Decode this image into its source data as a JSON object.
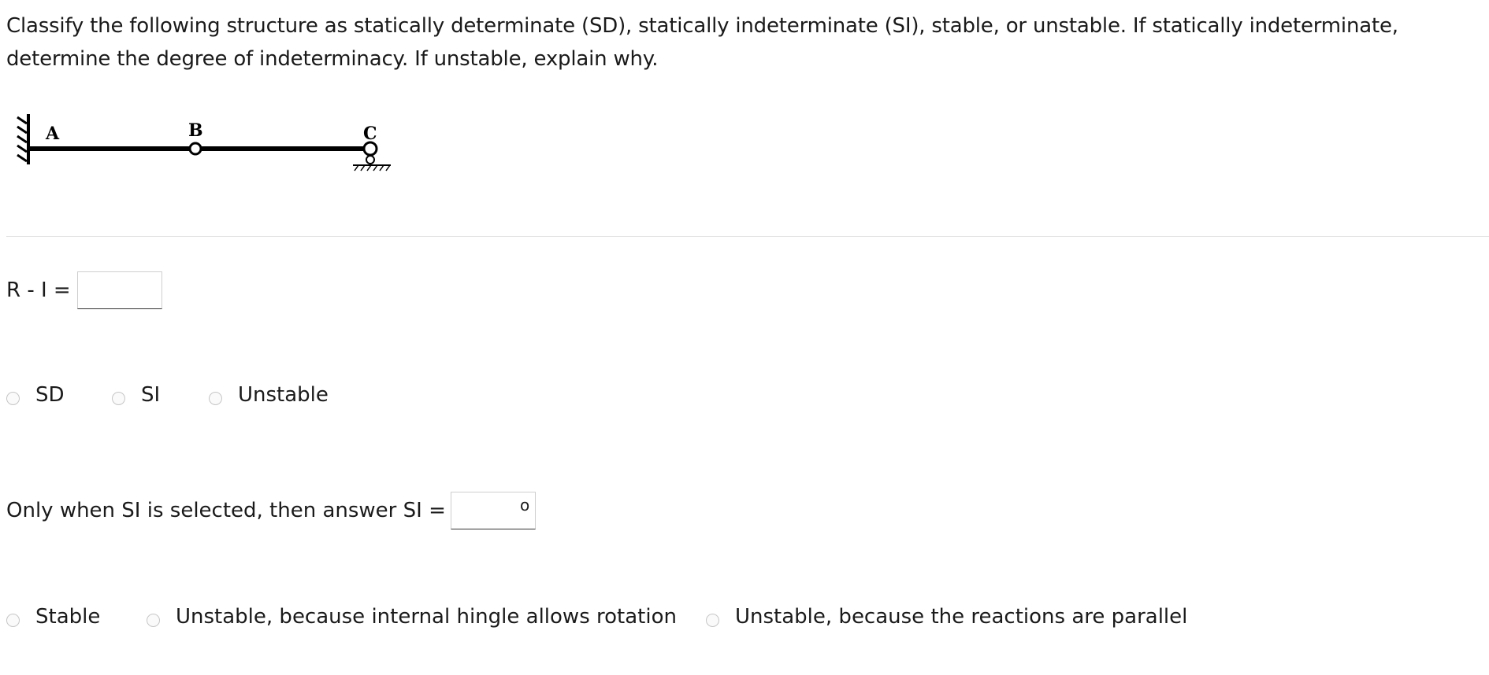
{
  "question": {
    "text": "Classify the following structure as statically determinate (SD), statically indeterminate (SI), stable, or unstable. If statically indeterminate, determine the degree of indeterminacy.  If unstable, explain why."
  },
  "figure": {
    "labels": {
      "a": "A",
      "b": "B",
      "c": "C"
    }
  },
  "r_minus_i": {
    "label": "R - I =",
    "value": ""
  },
  "classification": {
    "options": [
      {
        "label": "SD",
        "selected": false
      },
      {
        "label": "SI",
        "selected": false
      },
      {
        "label": "Unstable",
        "selected": false
      }
    ]
  },
  "si_answer": {
    "label": "Only when SI is selected, then answer SI =",
    "value": "",
    "degree_symbol": "o"
  },
  "stability": {
    "options": [
      {
        "label": "Stable",
        "selected": false
      },
      {
        "label": "Unstable, because internal hingle allows rotation",
        "selected": false
      },
      {
        "label": "Unstable, because the reactions are parallel",
        "selected": false
      }
    ]
  }
}
